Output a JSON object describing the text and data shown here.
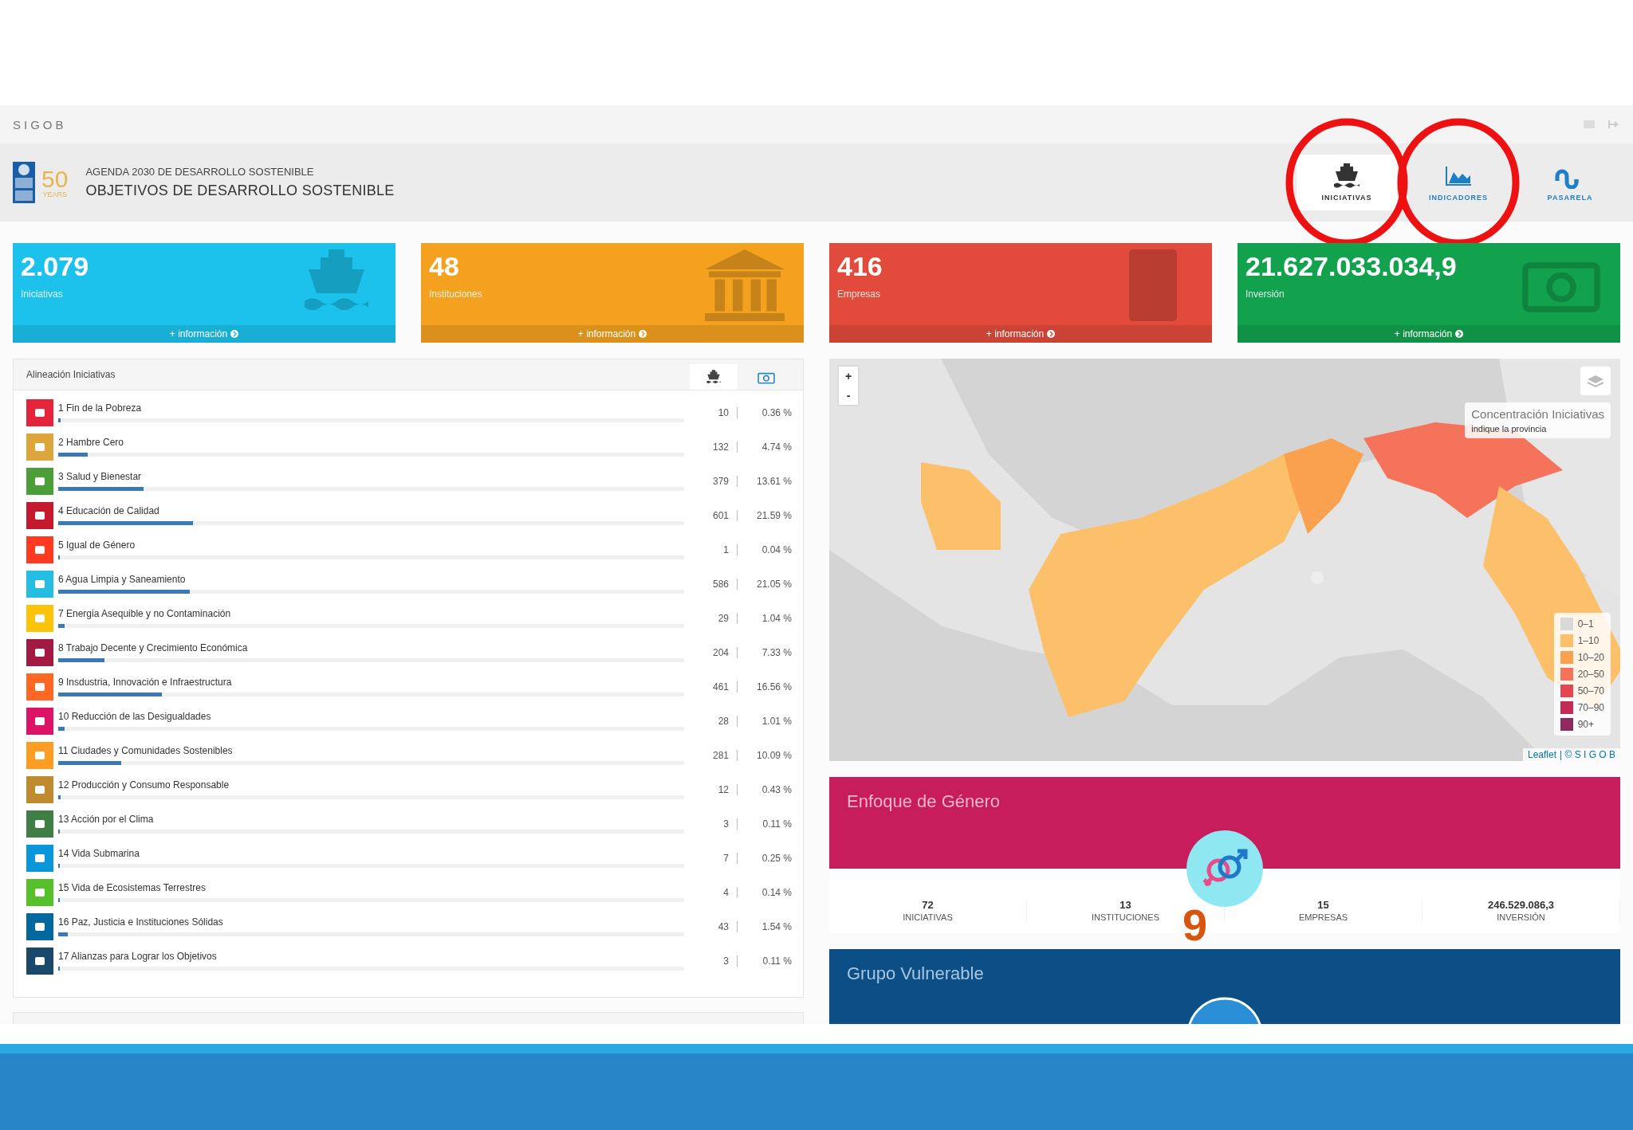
{
  "app_bar": {
    "brand": "SIGOB"
  },
  "header": {
    "logo_number": "50",
    "logo_word": "YEARS",
    "subtitle": "AGENDA 2030 DE DESARROLLO SOSTENIBLE",
    "title": "OBJETIVOS DE DESARROLLO SOSTENIBLE"
  },
  "nav": [
    {
      "label": "INICIATIVAS",
      "circled": true,
      "selected": true
    },
    {
      "label": "INDICADORES",
      "circled": true,
      "selected": false
    },
    {
      "label": "PASARELA",
      "circled": false,
      "selected": false
    }
  ],
  "cards": [
    {
      "value": "2.079",
      "label": "Iniciativas",
      "link": "+ información",
      "color": "#1cc2ec"
    },
    {
      "value": "48",
      "label": "Instituciones",
      "link": "+ información",
      "color": "#f3a11f"
    },
    {
      "value": "416",
      "label": "Empresas",
      "link": "+ información",
      "color": "#e24b3c"
    },
    {
      "value": "21.627.033.034,9",
      "label": "Inversión",
      "link": "+ información",
      "color": "#12a24d"
    }
  ],
  "alignment": {
    "title": "Alineación Iniciativas",
    "tabs": [
      {
        "selected": true
      },
      {
        "selected": false
      }
    ],
    "rows": [
      {
        "label": "1 Fin de la Pobreza",
        "count": "10",
        "percent": "0.36 %",
        "level": 0.0036,
        "color": "#e5243b"
      },
      {
        "label": "2 Hambre Cero",
        "count": "132",
        "percent": "4.74 %",
        "level": 0.0474,
        "color": "#dda63a"
      },
      {
        "label": "3 Salud y Bienestar",
        "count": "379",
        "percent": "13.61 %",
        "level": 0.1361,
        "color": "#4c9f38"
      },
      {
        "label": "4 Educación de Calidad",
        "count": "601",
        "percent": "21.59 %",
        "level": 0.2159,
        "color": "#c5192d"
      },
      {
        "label": "5 Igual de Género",
        "count": "1",
        "percent": "0.04 %",
        "level": 0.0004,
        "color": "#ff3a21"
      },
      {
        "label": "6 Agua Limpia y Saneamiento",
        "count": "586",
        "percent": "21.05 %",
        "level": 0.2105,
        "color": "#26bde2"
      },
      {
        "label": "7 Energia Asequible y no Contaminación",
        "count": "29",
        "percent": "1.04 %",
        "level": 0.0104,
        "color": "#fcc30b"
      },
      {
        "label": "8 Trabajo Decente y Crecimiento Económica",
        "count": "204",
        "percent": "7.33 %",
        "level": 0.0733,
        "color": "#a21942"
      },
      {
        "label": "9 Insdustria, Innovación e Infraestructura",
        "count": "461",
        "percent": "16.56 %",
        "level": 0.1656,
        "color": "#fd6925"
      },
      {
        "label": "10 Reducción de las Desigualdades",
        "count": "28",
        "percent": "1.01 %",
        "level": 0.0101,
        "color": "#dd1367"
      },
      {
        "label": "11 Ciudades y Comunidades Sostenibles",
        "count": "281",
        "percent": "10.09 %",
        "level": 0.1009,
        "color": "#fd9d24"
      },
      {
        "label": "12 Producción y Consumo Responsable",
        "count": "12",
        "percent": "0.43 %",
        "level": 0.0043,
        "color": "#bf8b2e"
      },
      {
        "label": "13 Acción por el Clima",
        "count": "3",
        "percent": "0.11 %",
        "level": 0.0011,
        "color": "#3f7e44"
      },
      {
        "label": "14 Vida Submarina",
        "count": "7",
        "percent": "0.25 %",
        "level": 0.0025,
        "color": "#0a97d9"
      },
      {
        "label": "15 Vida de Ecosistemas Terrestres",
        "count": "4",
        "percent": "0.14 %",
        "level": 0.0014,
        "color": "#56c02b"
      },
      {
        "label": "16 Paz, Justicia e Instituciones Sólidas",
        "count": "43",
        "percent": "1.54 %",
        "level": 0.0154,
        "color": "#00689d"
      },
      {
        "label": "17 Alianzas para Lograr los Objetivos",
        "count": "3",
        "percent": "0.11 %",
        "level": 0.0011,
        "color": "#19486a"
      }
    ]
  },
  "map": {
    "zoom_in": "+",
    "zoom_out": "-",
    "info_title": "Concentración Iniciativas",
    "info_hint": "indique la provincia",
    "legend": [
      {
        "label": "0–1",
        "color": "#d9d9d9"
      },
      {
        "label": "1–10",
        "color": "#fdc06a"
      },
      {
        "label": "10–20",
        "color": "#f9a14f"
      },
      {
        "label": "20–50",
        "color": "#f5735a"
      },
      {
        "label": "50–70",
        "color": "#e4474f"
      },
      {
        "label": "70–90",
        "color": "#c42a52"
      },
      {
        "label": "90+",
        "color": "#8e2a5c"
      }
    ],
    "attribution_link": "Leaflet",
    "attribution": "| © S I G O B"
  },
  "gender": {
    "title": "Enfoque de Género",
    "stats": [
      {
        "value": "72",
        "label": "INICIATIVAS"
      },
      {
        "value": "13",
        "label": "INSTITUCIONES"
      },
      {
        "value": "15",
        "label": "EMPRESAS"
      },
      {
        "value": "246.529.086,3",
        "label": "INVERSIÓN"
      }
    ]
  },
  "vulnerable": {
    "title": "Grupo Vulnerable"
  },
  "slide": {
    "page_number": "9"
  }
}
